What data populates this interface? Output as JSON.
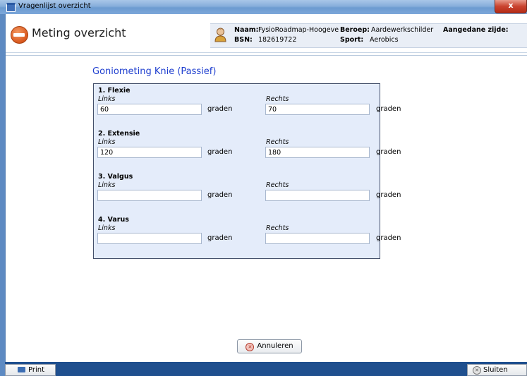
{
  "window": {
    "title": "Vragenlijst overzicht",
    "close_glyph": "x"
  },
  "header": {
    "title": "Meting overzicht",
    "info": {
      "naam_label": "Naam:",
      "naam_value": "FysioRoadmap-Hoogeve",
      "beroep_label": "Beroep:",
      "beroep_value": "Aardewerkschilder",
      "aangedane_label": "Aangedane zijde:",
      "bsn_label": "BSN:",
      "bsn_value": "182619722",
      "sport_label": "Sport:",
      "sport_value": "Aerobics"
    }
  },
  "form": {
    "title": "Goniometing Knie (Passief)",
    "left_label": "Links",
    "right_label": "Rechts",
    "unit": "graden",
    "questions": [
      {
        "title": "1. Flexie",
        "left": "60",
        "right": "70"
      },
      {
        "title": "2. Extensie",
        "left": "120",
        "right": "180"
      },
      {
        "title": "3. Valgus",
        "left": "",
        "right": ""
      },
      {
        "title": "4. Varus",
        "left": "",
        "right": ""
      }
    ]
  },
  "buttons": {
    "cancel": "Annuleren",
    "print": "Print",
    "close": "Sluiten"
  },
  "colors": {
    "accent_title": "#1f3fcf",
    "panel_bg": "#e4ecfa",
    "bottom_bar": "#1f4f8e"
  },
  "icons": [
    "window-icon",
    "measure-icon",
    "person-icon",
    "cancel-icon",
    "printer-icon",
    "close-icon"
  ]
}
